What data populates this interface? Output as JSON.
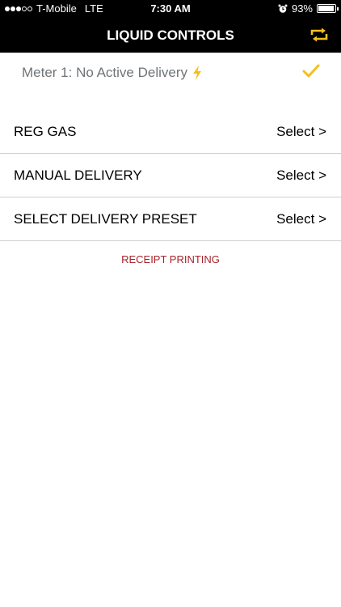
{
  "status_bar": {
    "carrier": "T-Mobile",
    "network": "LTE",
    "time": "7:30 AM",
    "battery": "93%",
    "battery_level": 0.93
  },
  "header": {
    "title": "LIQUID CONTROLS",
    "action_icon": "repeat-icon",
    "accent": "#f2c01e"
  },
  "meter": {
    "status": "Meter 1: No Active Delivery",
    "bolt_icon": "lightning-bolt-icon",
    "check_icon": "checkmark-icon"
  },
  "rows": [
    {
      "label": "REG GAS",
      "action": "Select >"
    },
    {
      "label": "MANUAL DELIVERY",
      "action": "Select >"
    },
    {
      "label": "SELECT DELIVERY PRESET",
      "action": "Select >"
    }
  ],
  "footer": {
    "receipt_link": "RECEIPT PRINTING",
    "link_color": "#a8232a"
  }
}
